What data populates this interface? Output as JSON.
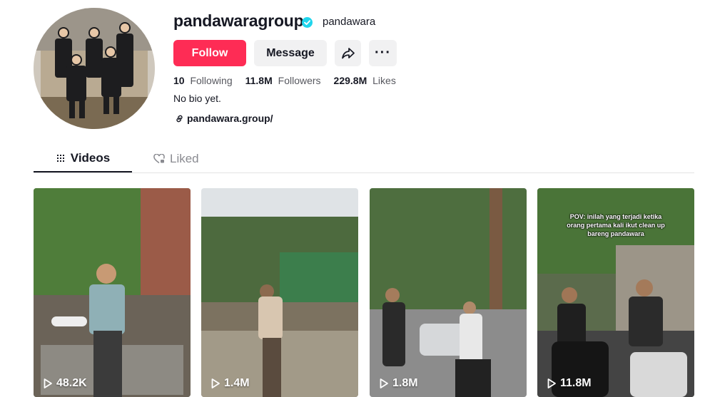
{
  "profile": {
    "username": "pandawaragroup",
    "nickname": "pandawara",
    "follow_label": "Follow",
    "message_label": "Message",
    "more_label": "···",
    "bio": "No bio yet.",
    "link": "pandawara.group/"
  },
  "stats": {
    "following_count": "10",
    "following_label": "Following",
    "followers_count": "11.8M",
    "followers_label": "Followers",
    "likes_count": "229.8M",
    "likes_label": "Likes"
  },
  "tabs": {
    "videos": "Videos",
    "liked": "Liked"
  },
  "videos": [
    {
      "views": "48.2K",
      "caption": ""
    },
    {
      "views": "1.4M",
      "caption": ""
    },
    {
      "views": "1.8M",
      "caption": ""
    },
    {
      "views": "11.8M",
      "caption": "POV: inilah yang terjadi ketika orang pertama kali ikut clean up bareng pandawara"
    }
  ],
  "colors": {
    "follow": "#fe2c55",
    "verified": "#20d5ec",
    "button_gray": "#f1f1f2"
  }
}
